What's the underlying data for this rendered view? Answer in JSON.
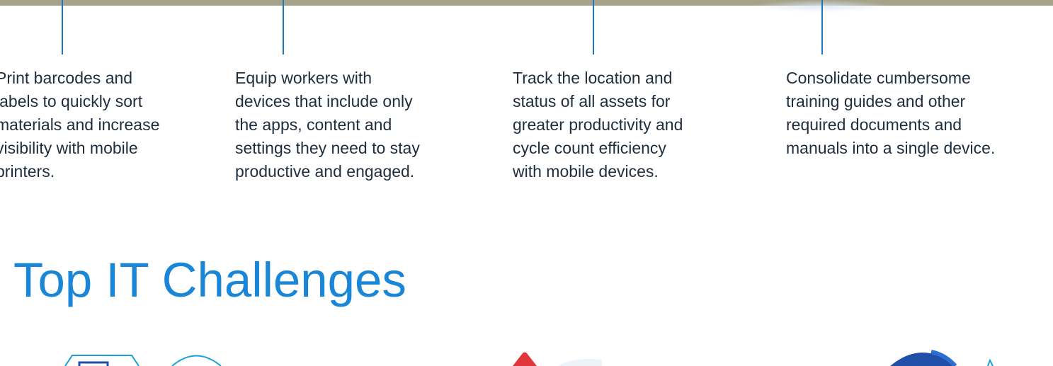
{
  "features": [
    {
      "lines": "Print barcodes and\nlabels to quickly sort\nmaterials and increase\nvisibility with mobile\nprinters."
    },
    {
      "lines": "Equip workers with\ndevices that include only\nthe apps, content and\nsettings they need to stay\nproductive and engaged."
    },
    {
      "lines": "Track the location and\nstatus of all assets for\ngreater productivity and\ncycle count efficiency\nwith mobile devices."
    },
    {
      "lines": "Consolidate cumbersome\ntraining guides and other\nrequired documents and\nmanuals into a single device."
    }
  ],
  "section": {
    "title": "Top IT Challenges"
  },
  "icons": {
    "left_pair": [
      "tablet-outline-icon",
      "circle-outline-icon"
    ],
    "center": "red-warning-icon",
    "right": "blue-globe-icon"
  },
  "colors": {
    "band": "#a7a28a",
    "connector": "#1a78c9",
    "title": "#1a86d8",
    "text": "#1f2d3d",
    "icon_outline": "#1aa0d8",
    "alert_red": "#e0353b",
    "globe_blue": "#1f4fa6"
  }
}
